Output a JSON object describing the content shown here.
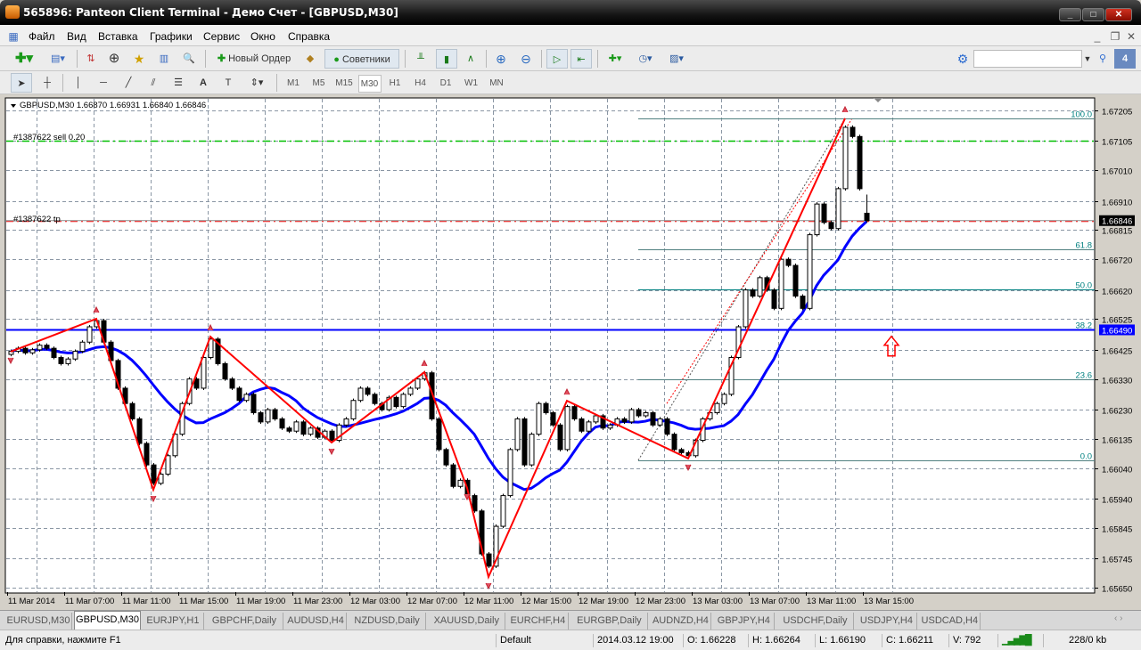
{
  "window": {
    "title": "565896: Panteon Client Terminal - Демо Счет - [GBPUSD,M30]",
    "min": "_",
    "max": "□",
    "close": "✕"
  },
  "menu": [
    "Файл",
    "Вид",
    "Вставка",
    "Графики",
    "Сервис",
    "Окно",
    "Справка"
  ],
  "toolbar": {
    "new_order": "Новый Ордер",
    "experts": "Советники",
    "search_placeholder": ""
  },
  "timeframes": [
    "M1",
    "M5",
    "M15",
    "M30",
    "H1",
    "H4",
    "D1",
    "W1",
    "MN"
  ],
  "active_timeframe": "M30",
  "chart": {
    "header": "GBPUSD,M30  1.66870 1.66931 1.66840 1.66846",
    "order_label": "#1387622 sell 0.20",
    "tp_label": "#1387622 tp",
    "sell_price": 1.67105,
    "tp_price": 1.66846,
    "bid": 1.66846,
    "bid_label": "1.66846",
    "hline_price": 1.6649,
    "hline_label": "1.66490",
    "price_labels": [
      "1.67205",
      "1.67105",
      "1.67010",
      "1.66910",
      "1.66815",
      "1.66720",
      "1.66620",
      "1.66525",
      "1.66425",
      "1.66330",
      "1.66230",
      "1.66135",
      "1.66040",
      "1.65940",
      "1.65845",
      "1.65745",
      "1.65650"
    ],
    "time_labels": [
      "11 Mar 2014",
      "11 Mar 07:00",
      "11 Mar 11:00",
      "11 Mar 15:00",
      "11 Mar 19:00",
      "11 Mar 23:00",
      "12 Mar 03:00",
      "12 Mar 07:00",
      "12 Mar 11:00",
      "12 Mar 15:00",
      "12 Mar 19:00",
      "12 Mar 23:00",
      "13 Mar 03:00",
      "13 Mar 07:00",
      "13 Mar 11:00",
      "13 Mar 15:00"
    ],
    "last_candle": {
      "o": 1.6687,
      "h": 1.66931,
      "l": 1.6684,
      "c": 1.66846
    },
    "first_open": 1.6641,
    "closes": [
      1.6642,
      1.6643,
      1.66415,
      1.66425,
      1.6644,
      1.6643,
      1.664,
      1.6638,
      1.66395,
      1.6642,
      1.6645,
      1.665,
      1.6652,
      1.6645,
      1.6639,
      1.663,
      1.6625,
      1.662,
      1.6612,
      1.6605,
      1.6599,
      1.6602,
      1.6608,
      1.6615,
      1.6625,
      1.6633,
      1.663,
      1.664,
      1.6646,
      1.6638,
      1.6633,
      1.663,
      1.6626,
      1.6628,
      1.6622,
      1.6619,
      1.6623,
      1.662,
      1.6617,
      1.6616,
      1.6619,
      1.6615,
      1.6617,
      1.6614,
      1.6616,
      1.6613,
      1.6618,
      1.662,
      1.6626,
      1.663,
      1.6628,
      1.6625,
      1.6623,
      1.6627,
      1.6624,
      1.6628,
      1.663,
      1.6633,
      1.6635,
      1.662,
      1.661,
      1.6605,
      1.6598,
      1.66,
      1.6595,
      1.659,
      1.6576,
      1.6572,
      1.6585,
      1.6595,
      1.661,
      1.662,
      1.6605,
      1.6615,
      1.6625,
      1.6622,
      1.6618,
      1.661,
      1.6624,
      1.662,
      1.6616,
      1.6619,
      1.6621,
      1.6617,
      1.6618,
      1.662,
      1.6619,
      1.6623,
      1.6621,
      1.6622,
      1.6618,
      1.662,
      1.6615,
      1.661,
      1.6609,
      1.6608,
      1.6613,
      1.662,
      1.6622,
      1.6625,
      1.6628,
      1.664,
      1.665,
      1.6662,
      1.666,
      1.6666,
      1.6662,
      1.6656,
      1.6672,
      1.667,
      1.666,
      1.6656,
      1.668,
      1.669,
      1.6684,
      1.6682,
      1.6695,
      1.6715,
      1.6712,
      1.6695,
      1.66846
    ],
    "wick": 6e-05,
    "ma_period": 13,
    "zigzag": [
      [
        0,
        1.66419
      ],
      [
        12,
        1.66526
      ],
      [
        20,
        1.65969
      ],
      [
        28,
        1.66468
      ],
      [
        45,
        1.66123
      ],
      [
        58,
        1.66352
      ],
      [
        64,
        1.65975
      ],
      [
        67,
        1.65685
      ],
      [
        78,
        1.66259
      ],
      [
        95,
        1.66071
      ],
      [
        117,
        1.67179
      ]
    ],
    "fib": {
      "start_index": 88,
      "low": 1.66065,
      "high": 1.67179,
      "levels": [
        {
          "ratio": 1,
          "label": "100.0"
        },
        {
          "ratio": 0.618,
          "label": "61.8"
        },
        {
          "ratio": 0.5,
          "label": "50.0"
        },
        {
          "ratio": 0.382,
          "label": "38.2"
        },
        {
          "ratio": 0.236,
          "label": "23.6"
        },
        {
          "ratio": 0,
          "label": "0.0"
        }
      ]
    },
    "arrow_price": 1.6644,
    "colors": {
      "zigzag": "#ff0000",
      "ma": "#0000ff",
      "fib": "#008080",
      "hline": "#0000ff",
      "sell": "#00c000",
      "tp": "#ff0000"
    }
  },
  "tabs": [
    "EURUSD,M30",
    "GBPUSD,M30",
    "EURJPY,H1",
    "GBPCHF,Daily",
    "AUDUSD,H4",
    "NZDUSD,Daily",
    "XAUUSD,Daily",
    "EURCHF,H4",
    "EURGBP,Daily",
    "AUDNZD,H4",
    "GBPJPY,H4",
    "USDCHF,Daily",
    "USDJPY,H4",
    "USDCAD,H4"
  ],
  "active_tab": "GBPUSD,M30",
  "status": {
    "help": "Для справки, нажмите F1",
    "profile": "Default",
    "time": "2014.03.12 19:00",
    "open": "O: 1.66228",
    "high": "H: 1.66264",
    "low": "L: 1.66190",
    "close": "C: 1.66211",
    "volume": "V: 792",
    "traffic": "228/0 kb"
  }
}
